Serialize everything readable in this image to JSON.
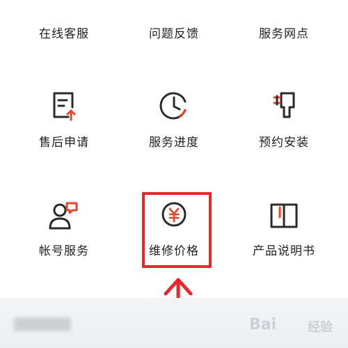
{
  "colors": {
    "accent": "#e8462b",
    "icon_stroke": "#2a2a2a",
    "highlight": "#e8262b",
    "text": "#1f1f1f"
  },
  "grid": [
    {
      "label": "在线客服",
      "icon": "headset-icon"
    },
    {
      "label": "问题反馈",
      "icon": "chat-bubble-icon"
    },
    {
      "label": "服务网点",
      "icon": "map-location-icon"
    },
    {
      "label": "售后申请",
      "icon": "document-upload-icon"
    },
    {
      "label": "服务进度",
      "icon": "clock-icon"
    },
    {
      "label": "预约安装",
      "icon": "install-plug-icon"
    },
    {
      "label": "帐号服务",
      "icon": "account-user-icon"
    },
    {
      "label": "维修价格",
      "icon": "yen-coin-icon"
    },
    {
      "label": "产品说明书",
      "icon": "manual-book-icon"
    }
  ],
  "annotation": {
    "highlighted_item": "维修价格"
  },
  "watermark": {
    "logo": "Bai",
    "suffix": "经验"
  }
}
